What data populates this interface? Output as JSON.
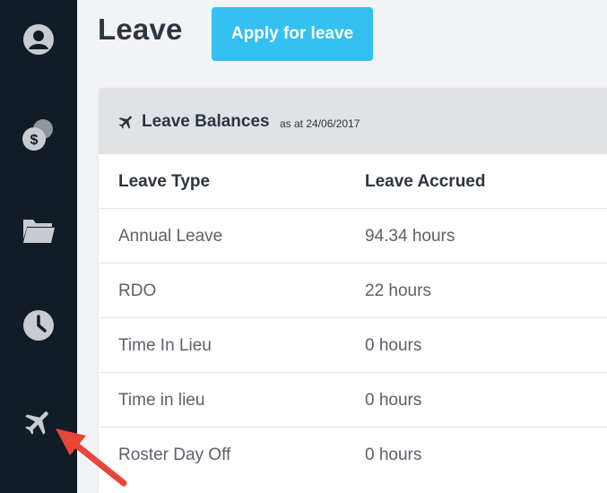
{
  "page": {
    "title": "Leave",
    "apply_button_label": "Apply for leave"
  },
  "sidebar": {
    "items": [
      {
        "icon": "user-icon"
      },
      {
        "icon": "coins-icon"
      },
      {
        "icon": "folder-icon"
      },
      {
        "icon": "clock-icon"
      },
      {
        "icon": "airplane-icon",
        "active": true
      }
    ]
  },
  "balances": {
    "title": "Leave Balances",
    "as_at": "as at 24/06/2017",
    "columns": [
      "Leave Type",
      "Leave Accrued"
    ],
    "rows": [
      {
        "type": "Annual Leave",
        "accrued": "94.34 hours"
      },
      {
        "type": "RDO",
        "accrued": "22 hours"
      },
      {
        "type": "Time In Lieu",
        "accrued": "0 hours"
      },
      {
        "type": "Time in lieu",
        "accrued": "0 hours"
      },
      {
        "type": "Roster Day Off",
        "accrued": "0 hours"
      }
    ]
  },
  "colors": {
    "sidebar_bg": "#111c27",
    "icon_gray": "#c8ccd0",
    "accent": "#34c0f0",
    "annotation_arrow": "#e8463a"
  }
}
